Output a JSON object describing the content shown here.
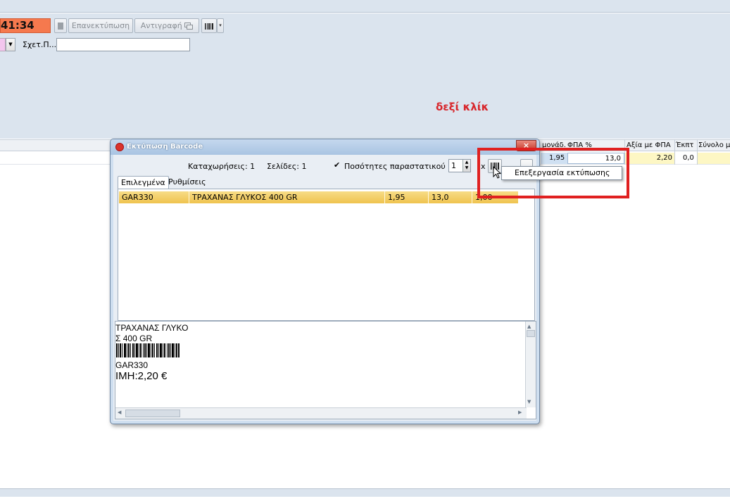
{
  "toolbar": {
    "timer_text": "41:34",
    "reprint_label": "Επανεκτύπωση",
    "copy_label": "Αντιγραφή",
    "related_label": "Σχετ.Π...",
    "related_value": ""
  },
  "annotation": "δεξί κλίκ",
  "main_grid": {
    "headers": [
      "μονάδ.",
      "ΦΠΑ %",
      "Αξία με ΦΠΑ",
      "Έκπτ",
      "Σύνολο μ"
    ],
    "row": {
      "unit_price": "1,95",
      "vat": "13,0",
      "value_with_vat": "2,20",
      "discount": "0,0"
    }
  },
  "dialog": {
    "title": "Εκτύπωση Barcode",
    "close_label": "×",
    "entries_label": "Καταχωρήσεις: 1",
    "pages_label": "Σελίδες: 1",
    "doc_qty_label": "Ποσότητες παραστατικού",
    "doc_qty_checked": true,
    "copies_value": "1",
    "multiply_label": "x",
    "tabs": [
      "Επιλεγμένα",
      "Ρυθμίσεις"
    ],
    "items": [
      {
        "code": "GAR330",
        "description": "ΤΡΑΧΑΝΑΣ ΓΛΥΚΟΣ 400 GR",
        "price": "1,95",
        "vat": "13,0",
        "qty": "1,00"
      }
    ],
    "preview": {
      "line1": "ΤΡΑΧΑΝΑΣ ΓΛΥΚΟ",
      "line2": "Σ 400 GR",
      "code": "GAR330",
      "price": "ΙΜΗ:2,20 €"
    }
  },
  "context_menu": {
    "items": [
      "Επεξεργασία εκτύπωσης"
    ]
  },
  "colors": {
    "timer_bg": "#f5794e",
    "annotation": "#d8262b",
    "highlight_box": "#e02020",
    "selected_row": "#efc34f"
  }
}
